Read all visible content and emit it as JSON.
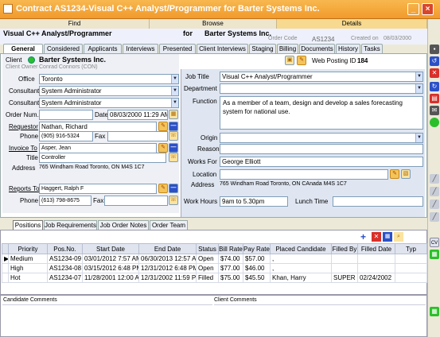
{
  "window": {
    "title": "Contract AS1234-Visual C++ Analyst/Programmer for Barter Systems Inc."
  },
  "modes": [
    "Find",
    "Browse",
    "Details"
  ],
  "record": {
    "title": "Visual C++ Analyst/Programmer",
    "for_label": "for",
    "company": "Barter Systems Inc.",
    "order_code_label": "Order Code",
    "order_code": "AS1234",
    "created_on_label": "Created on",
    "created_on": "08/03/2000"
  },
  "tabs": [
    "General",
    "Considered",
    "Applicants",
    "Interviews",
    "Presented",
    "Client Interviews",
    "Staging",
    "Billing",
    "Documents",
    "History",
    "Tasks"
  ],
  "general": {
    "client_label": "Client",
    "client": "Barter Systems Inc.",
    "client_owner_label": "Client Owner",
    "client_owner": "Conrad Connors (CON)",
    "web_posting_label": "Web Posting ID",
    "web_posting_id": "184",
    "office_label": "Office",
    "office": "Toronto",
    "consultant_label": "Consultant",
    "consultant1": "System Administrator",
    "consultant2": "System Administrator",
    "order_num_label": "Order Num.",
    "order_num": "",
    "date_label": "Date",
    "date": "08/03/2000 11:29 AM",
    "requestor_label": "Requestor",
    "requestor": "Nathan, Richard",
    "phone_label": "Phone",
    "phone1": "(905) 916-5324",
    "fax_label": "Fax",
    "fax1": "",
    "invoice_to_label": "Invoice To",
    "invoice_to": "Asper, Jean",
    "title_label": "Title",
    "title": "Controller",
    "address_label": "Address",
    "address1": "765 Windham Road   Toronto, ON M4S 1C7",
    "reports_to_label": "Reports To",
    "reports_to": "Haggert, Ralph F",
    "phone2": "(613) 798-8675",
    "fax2": "",
    "job_title_label": "Job Title",
    "job_title": "Visual C++ Analyst/Programmer",
    "department_label": "Department",
    "department": "",
    "function_label": "Function",
    "function": "As a member of a team, design and develop a sales forecasting system for national use.",
    "origin_label": "Origin",
    "origin": "",
    "reason_label": "Reason",
    "reason": "",
    "works_for_label": "Works For",
    "works_for": "George Elliott",
    "location_label": "Location",
    "location": "",
    "address2": "765 Windham Road   Toronto, ON CAnada M4S 1C7",
    "work_hours_label": "Work Hours",
    "work_hours": "9am to 5.30pm",
    "lunch_time_label": "Lunch Time",
    "lunch_time": ""
  },
  "subtabs": [
    "Positions",
    "Job Requirements",
    "Job Order Notes",
    "Order Team"
  ],
  "grid": {
    "columns": [
      "Priority",
      "Pos.No.",
      "Start Date",
      "End Date",
      "Status",
      "Bill Rate",
      "Pay Rate",
      "Placed Candidate",
      "Filled By",
      "Filled Date",
      "Typ"
    ],
    "rows": [
      [
        "Medium",
        "AS1234-09",
        "03/01/2012 7:57 AM",
        "06/30/2013 12:57 AM",
        "Open",
        "$74.00",
        "$57.00",
        ",",
        "",
        "",
        ""
      ],
      [
        "High",
        "AS1234-08",
        "03/15/2012 6:48 PM",
        "12/31/2012 6:48 PM",
        "Open",
        "$77.00",
        "$46.00",
        ",",
        "",
        "",
        ""
      ],
      [
        "Hot",
        "AS1234-07",
        "11/28/2001 12:00 AM",
        "12/31/2002 11:59 PM",
        "Filled",
        "$75.00",
        "$45.50",
        "Khan, Harry",
        "SUPER",
        "02/24/2002",
        ""
      ]
    ]
  },
  "comments": {
    "candidate": "Candidate Comments",
    "client": "Client Comments"
  },
  "colors": {
    "titlebar": "#f19a2b",
    "details_tab": "#f7d98f",
    "accent": "#2b50c8"
  }
}
